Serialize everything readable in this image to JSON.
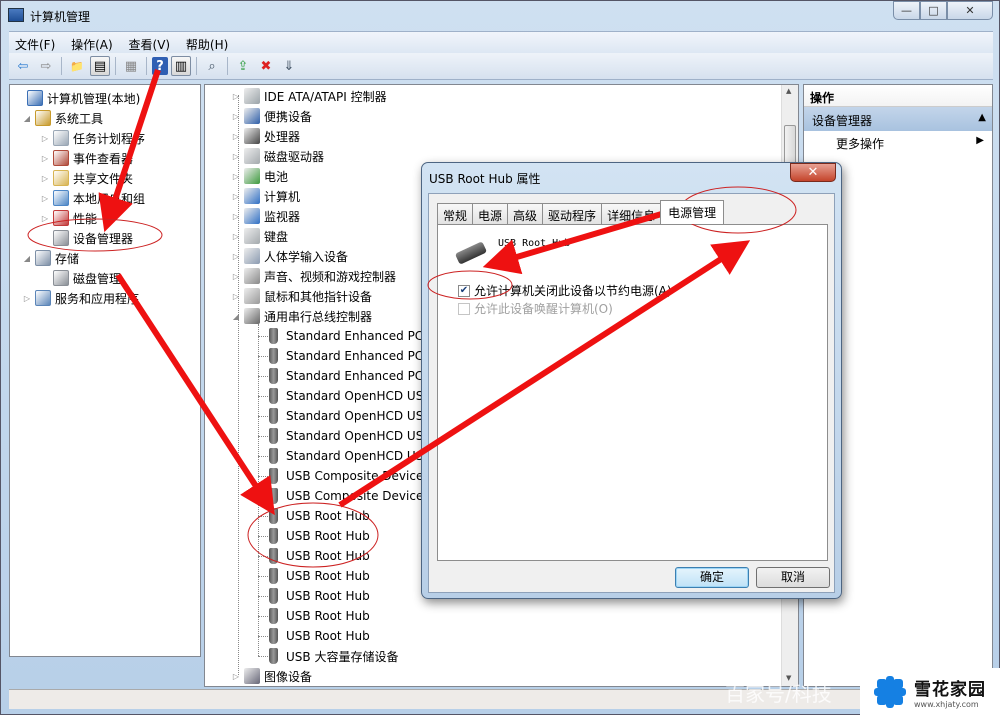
{
  "window": {
    "title": "计算机管理",
    "controls": {
      "minimize": "▭",
      "maximize": "□",
      "close": "✕"
    }
  },
  "menubar": [
    {
      "label": "文件(F)"
    },
    {
      "label": "操作(A)"
    },
    {
      "label": "查看(V)"
    },
    {
      "label": "帮助(H)"
    }
  ],
  "toolbar": [
    {
      "icon": "back-arrow-icon",
      "glyph": "⇦"
    },
    {
      "icon": "forward-arrow-icon",
      "glyph": "⇨"
    },
    {
      "icon": "up-folder-icon",
      "glyph": "📁"
    },
    {
      "icon": "show-hide-tree-icon",
      "glyph": "▤"
    },
    {
      "icon": "properties-icon",
      "glyph": "▦"
    },
    {
      "icon": "help-icon",
      "glyph": "?"
    },
    {
      "icon": "show-action-pane-icon",
      "glyph": "▥"
    },
    {
      "icon": "scan-hardware-icon",
      "glyph": "⌕"
    },
    {
      "icon": "update-driver-icon",
      "glyph": "⇪"
    },
    {
      "icon": "uninstall-device-icon",
      "glyph": "✖"
    },
    {
      "icon": "disable-device-icon",
      "glyph": "⇓"
    }
  ],
  "left_tree": [
    {
      "label": "计算机管理(本地)",
      "level": 0,
      "expander": "",
      "icon_color": "#3b6fb5"
    },
    {
      "label": "系统工具",
      "level": 1,
      "expander": "◢",
      "icon_color": "#c79a2b"
    },
    {
      "label": "任务计划程序",
      "level": 2,
      "expander": "▷",
      "icon_color": "#9aa7b5"
    },
    {
      "label": "事件查看器",
      "level": 2,
      "expander": "▷",
      "icon_color": "#b04a3a"
    },
    {
      "label": "共享文件夹",
      "level": 2,
      "expander": "▷",
      "icon_color": "#d8b452"
    },
    {
      "label": "本地用户和组",
      "level": 2,
      "expander": "▷",
      "icon_color": "#4c86c6"
    },
    {
      "label": "性能",
      "level": 2,
      "expander": "▷",
      "icon_color": "#c23a3a"
    },
    {
      "label": "设备管理器",
      "level": 2,
      "expander": "",
      "icon_color": "#8a8f96"
    },
    {
      "label": "存储",
      "level": 1,
      "expander": "◢",
      "icon_color": "#7d8fa6"
    },
    {
      "label": "磁盘管理",
      "level": 2,
      "expander": "",
      "icon_color": "#8a8f96"
    },
    {
      "label": "服务和应用程序",
      "level": 1,
      "expander": "▷",
      "icon_color": "#5b85b8"
    }
  ],
  "device_tree": {
    "categories_top": [
      {
        "label": "IDE ATA/ATAPI 控制器",
        "icon_color": "#9aa3a8"
      },
      {
        "label": "便携设备",
        "icon_color": "#2e5ea8"
      },
      {
        "label": "处理器",
        "icon_color": "#444"
      },
      {
        "label": "磁盘驱动器",
        "icon_color": "#a3a9ad"
      },
      {
        "label": "电池",
        "icon_color": "#3d9a3d"
      },
      {
        "label": "计算机",
        "icon_color": "#2f6fc4"
      },
      {
        "label": "监视器",
        "icon_color": "#2f6fc4"
      },
      {
        "label": "键盘",
        "icon_color": "#a3a9ad"
      },
      {
        "label": "人体学输入设备",
        "icon_color": "#8a9ab0"
      },
      {
        "label": "声音、视频和游戏控制器",
        "icon_color": "#888"
      },
      {
        "label": "鼠标和其他指针设备",
        "icon_color": "#999"
      },
      {
        "label": "通用串行总线控制器",
        "icon_color": "#666",
        "expanded": true
      }
    ],
    "usb_children": [
      {
        "label": "Standard Enhanced PCI"
      },
      {
        "label": "Standard Enhanced PCI"
      },
      {
        "label": "Standard Enhanced PCI"
      },
      {
        "label": "Standard OpenHCD US"
      },
      {
        "label": "Standard OpenHCD US"
      },
      {
        "label": "Standard OpenHCD US"
      },
      {
        "label": "Standard OpenHCD US"
      },
      {
        "label": "USB Composite Device"
      },
      {
        "label": "USB Composite Device"
      },
      {
        "label": "USB Root Hub"
      },
      {
        "label": "USB Root Hub"
      },
      {
        "label": "USB Root Hub"
      },
      {
        "label": "USB Root Hub"
      },
      {
        "label": "USB Root Hub"
      },
      {
        "label": "USB Root Hub"
      },
      {
        "label": "USB Root Hub"
      },
      {
        "label": "USB 大容量存储设备"
      }
    ],
    "categories_bottom": [
      {
        "label": "图像设备",
        "icon_color": "#667"
      }
    ]
  },
  "actions_pane": {
    "header": "操作",
    "section": "设备管理器",
    "section_toggle": "▲",
    "more": "更多操作",
    "more_arrow": "▶"
  },
  "dialog": {
    "title": "USB Root Hub 属性",
    "close": "✕",
    "tabs": [
      {
        "label": "常规",
        "active": false
      },
      {
        "label": "电源",
        "active": false
      },
      {
        "label": "高级",
        "active": false
      },
      {
        "label": "驱动程序",
        "active": false
      },
      {
        "label": "详细信息",
        "active": false
      },
      {
        "label": "电源管理",
        "active": true
      }
    ],
    "device_name": "USB Root Hub",
    "options": [
      {
        "label": "允许计算机关闭此设备以节约电源(A)",
        "checked": true,
        "enabled": true
      },
      {
        "label": "允许此设备唤醒计算机(O)",
        "checked": false,
        "enabled": false
      }
    ],
    "ok": "确定",
    "cancel": "取消"
  },
  "watermark": {
    "text": "百家号/科技",
    "logo_name": "雪花家园",
    "logo_url": "www.xhjaty.com",
    "brand_color": "#1580e3"
  },
  "annotation_color": "#ee1111"
}
